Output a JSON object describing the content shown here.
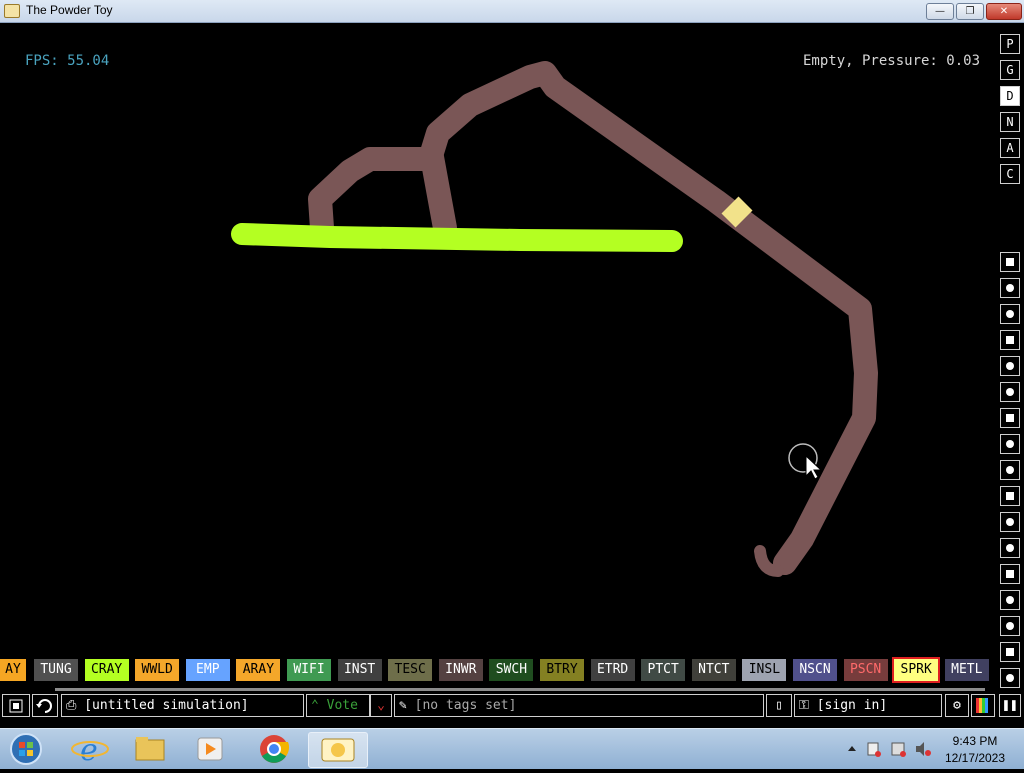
{
  "window": {
    "title": "The Powder Toy",
    "minimize": "—",
    "maximize": "❐",
    "close": "✕"
  },
  "hud": {
    "fps": "FPS: 55.04",
    "pressure": "Empty, Pressure: 0.03"
  },
  "side_modes": [
    {
      "label": "P",
      "active": false
    },
    {
      "label": "G",
      "active": false
    },
    {
      "label": "D",
      "active": true
    },
    {
      "label": "N",
      "active": false
    },
    {
      "label": "A",
      "active": false
    },
    {
      "label": "C",
      "active": false
    }
  ],
  "side_tools": [
    "walls-icon",
    "electronics-icon",
    "powered-icon",
    "sensors-icon",
    "force-icon",
    "explosives-icon",
    "gases-icon",
    "liquids-icon",
    "powders-icon",
    "solids-icon",
    "radioactive-icon",
    "special-icon",
    "life-icon",
    "tools-icon",
    "favorites-icon",
    "decoration-icon",
    "search-icon"
  ],
  "elements": [
    {
      "label": "AY",
      "bg": "#f5a623",
      "fg": "#000000"
    },
    {
      "label": "TUNG",
      "bg": "#505050",
      "fg": "#ffffff"
    },
    {
      "label": "CRAY",
      "bg": "#b4ff22",
      "fg": "#000000"
    },
    {
      "label": "WWLD",
      "bg": "#f4a72a",
      "fg": "#000000"
    },
    {
      "label": "EMP",
      "bg": "#66a3ff",
      "fg": "#ffffff"
    },
    {
      "label": "ARAY",
      "bg": "#f4a72a",
      "fg": "#000000"
    },
    {
      "label": "WIFI",
      "bg": "#3f9a52",
      "fg": "#ffffff"
    },
    {
      "label": "INST",
      "bg": "#404040",
      "fg": "#ffffff"
    },
    {
      "label": "TESC",
      "bg": "#6e6e4a",
      "fg": "#000000"
    },
    {
      "label": "INWR",
      "bg": "#544141",
      "fg": "#ffffff"
    },
    {
      "label": "SWCH",
      "bg": "#1f4d1f",
      "fg": "#ffffff"
    },
    {
      "label": "BTRY",
      "bg": "#848022",
      "fg": "#000000"
    },
    {
      "label": "ETRD",
      "bg": "#404040",
      "fg": "#ffffff"
    },
    {
      "label": "PTCT",
      "bg": "#404a45",
      "fg": "#ffffff"
    },
    {
      "label": "NTCT",
      "bg": "#40403a",
      "fg": "#ffffff"
    },
    {
      "label": "INSL",
      "bg": "#9ea3b0",
      "fg": "#000000"
    },
    {
      "label": "NSCN",
      "bg": "#50508c",
      "fg": "#ffffff"
    },
    {
      "label": "PSCN",
      "bg": "#773c3c",
      "fg": "#ff6a6a"
    },
    {
      "label": "SPRK",
      "bg": "#ffff80",
      "fg": "#000000",
      "selected": true
    },
    {
      "label": "METL",
      "bg": "#404060",
      "fg": "#ffffff"
    }
  ],
  "bottombar": {
    "save_name": "[untitled simulation]",
    "vote": "Vote",
    "tags": "[no tags set]",
    "signin": "[sign in]"
  },
  "taskbar": {
    "time": "9:43 PM",
    "date": "12/17/2023"
  }
}
